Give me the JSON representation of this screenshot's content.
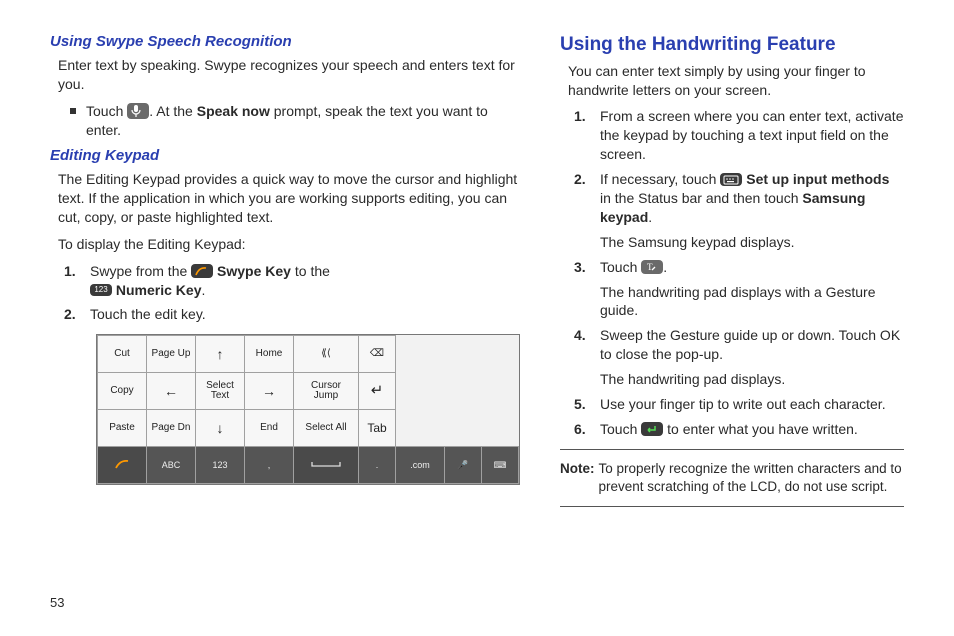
{
  "left": {
    "heading1": "Using Swype Speech Recognition",
    "p1": "Enter text by speaking. Swype recognizes your speech and enters text for you.",
    "bullet1_a": "Touch ",
    "bullet1_b": ". At the ",
    "bullet1_bold": "Speak now",
    "bullet1_c": " prompt, speak the text you want to enter.",
    "heading2": "Editing Keypad",
    "p2": "The Editing Keypad provides a quick way to move the cursor and highlight text. If the application in which you are working supports editing, you can cut, copy, or paste highlighted text.",
    "p3": "To display the Editing Keypad:",
    "step1_a": "Swype from the ",
    "step1_bold1": "Swype Key",
    "step1_b": " to the ",
    "step1_bold2": "Numeric Key",
    "step1_c": ".",
    "step2": "Touch the edit key.",
    "keypad": {
      "row1": [
        "Cut",
        "Page Up",
        "↑",
        "Home",
        "⟪⟨",
        "⌫"
      ],
      "row2": [
        "Copy",
        "←",
        "Select Text",
        "→",
        "Cursor Jump",
        "↵"
      ],
      "row3": [
        "Paste",
        "Page Dn",
        "↓",
        "End",
        "Select All",
        "Tab"
      ],
      "row4": [
        "",
        "ABC",
        "123",
        ",",
        "␣",
        ".",
        ".com",
        "🎤",
        "⌨"
      ]
    }
  },
  "right": {
    "heading": "Using the Handwriting Feature",
    "p1": "You can enter text simply by using your finger to handwrite letters on your screen.",
    "step1": "From a screen where you can enter text, activate the keypad by touching a text input field on the screen.",
    "step2_a": "If necessary, touch ",
    "step2_bold1": "Set up input methods",
    "step2_b": " in the Status bar and then touch ",
    "step2_bold2": "Samsung keypad",
    "step2_c": ".",
    "step2_after": "The Samsung keypad displays.",
    "step3_a": "Touch ",
    "step3_b": ".",
    "step3_after": "The handwriting pad displays with a Gesture guide.",
    "step4": "Sweep the Gesture guide up or down. Touch OK to close the pop-up.",
    "step4_after": "The handwriting pad displays.",
    "step5": "Use your finger tip to write out each character.",
    "step6_a": "Touch ",
    "step6_b": " to enter what you have written.",
    "note_label": "Note:",
    "note_body": "To properly recognize the written characters and to prevent scratching of the LCD, do not use script."
  },
  "page_number": "53",
  "icons": {
    "mic": "mic-icon",
    "swype": "swype-icon",
    "numeric": "numeric-123-icon",
    "keyboard_settings": "keyboard-settings-icon",
    "handwriting": "handwriting-t-icon",
    "enter": "enter-key-icon"
  }
}
